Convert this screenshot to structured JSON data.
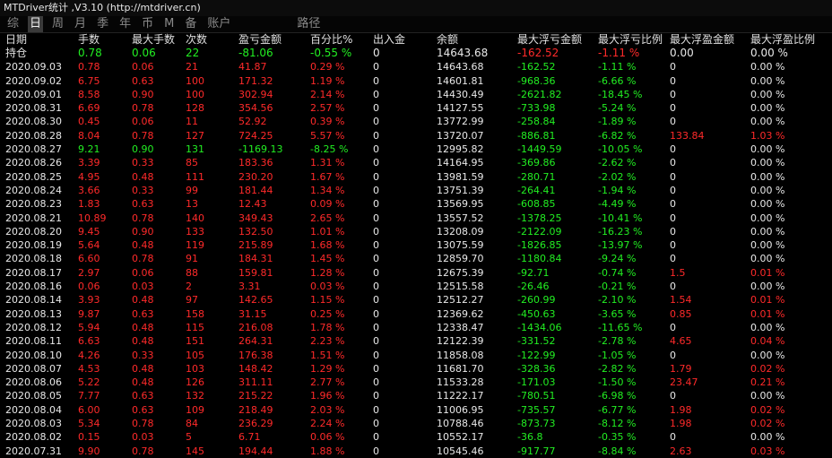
{
  "window_title": "MTDriver统计 ,V3.10 (http://mtdriver.cn)",
  "toolbar": {
    "buttons": [
      "综",
      "日",
      "周",
      "月",
      "季",
      "年",
      "币",
      "M",
      "备",
      "账户"
    ],
    "active_index": 1,
    "path_label": "路径"
  },
  "columns": [
    "日期",
    "手数",
    "最大手数",
    "次数",
    "盈亏金额",
    "百分比%",
    "出入金",
    "余额",
    "最大浮亏金额",
    "最大浮亏比例",
    "最大浮盈金额",
    "最大浮盈比例"
  ],
  "holding": {
    "label": "持仓",
    "values": [
      "0.78",
      "0.06",
      "22",
      "-81.06",
      "-0.55 %",
      "0",
      "14643.68",
      "-162.52",
      "-1.11 %",
      "0.00",
      "0.00 %"
    ]
  },
  "colors": {
    "loss": "#ff2a2a",
    "gain": "#22ee22",
    "text": "#e8e8e8",
    "background": "#000000"
  },
  "rows": [
    [
      "2020.09.03",
      "0.78",
      "0.06",
      "21",
      "41.87",
      "0.29 %",
      "0",
      "14643.68",
      "-162.52",
      "-1.11 %",
      "0",
      "0.00 %"
    ],
    [
      "2020.09.02",
      "6.75",
      "0.63",
      "100",
      "171.32",
      "1.19 %",
      "0",
      "14601.81",
      "-968.36",
      "-6.66 %",
      "0",
      "0.00 %"
    ],
    [
      "2020.09.01",
      "8.58",
      "0.90",
      "100",
      "302.94",
      "2.14 %",
      "0",
      "14430.49",
      "-2621.82",
      "-18.45 %",
      "0",
      "0.00 %"
    ],
    [
      "2020.08.31",
      "6.69",
      "0.78",
      "128",
      "354.56",
      "2.57 %",
      "0",
      "14127.55",
      "-733.98",
      "-5.24 %",
      "0",
      "0.00 %"
    ],
    [
      "2020.08.30",
      "0.45",
      "0.06",
      "11",
      "52.92",
      "0.39 %",
      "0",
      "13772.99",
      "-258.84",
      "-1.89 %",
      "0",
      "0.00 %"
    ],
    [
      "2020.08.28",
      "8.04",
      "0.78",
      "127",
      "724.25",
      "5.57 %",
      "0",
      "13720.07",
      "-886.81",
      "-6.82 %",
      "133.84",
      "1.03 %"
    ],
    [
      "2020.08.27",
      "9.21",
      "0.90",
      "131",
      "-1169.13",
      "-8.25 %",
      "0",
      "12995.82",
      "-1449.59",
      "-10.05 %",
      "0",
      "0.00 %"
    ],
    [
      "2020.08.26",
      "3.39",
      "0.33",
      "85",
      "183.36",
      "1.31 %",
      "0",
      "14164.95",
      "-369.86",
      "-2.62 %",
      "0",
      "0.00 %"
    ],
    [
      "2020.08.25",
      "4.95",
      "0.48",
      "111",
      "230.20",
      "1.67 %",
      "0",
      "13981.59",
      "-280.71",
      "-2.02 %",
      "0",
      "0.00 %"
    ],
    [
      "2020.08.24",
      "3.66",
      "0.33",
      "99",
      "181.44",
      "1.34 %",
      "0",
      "13751.39",
      "-264.41",
      "-1.94 %",
      "0",
      "0.00 %"
    ],
    [
      "2020.08.23",
      "1.83",
      "0.63",
      "13",
      "12.43",
      "0.09 %",
      "0",
      "13569.95",
      "-608.85",
      "-4.49 %",
      "0",
      "0.00 %"
    ],
    [
      "2020.08.21",
      "10.89",
      "0.78",
      "140",
      "349.43",
      "2.65 %",
      "0",
      "13557.52",
      "-1378.25",
      "-10.41 %",
      "0",
      "0.00 %"
    ],
    [
      "2020.08.20",
      "9.45",
      "0.90",
      "133",
      "132.50",
      "1.01 %",
      "0",
      "13208.09",
      "-2122.09",
      "-16.23 %",
      "0",
      "0.00 %"
    ],
    [
      "2020.08.19",
      "5.64",
      "0.48",
      "119",
      "215.89",
      "1.68 %",
      "0",
      "13075.59",
      "-1826.85",
      "-13.97 %",
      "0",
      "0.00 %"
    ],
    [
      "2020.08.18",
      "6.60",
      "0.78",
      "91",
      "184.31",
      "1.45 %",
      "0",
      "12859.70",
      "-1180.84",
      "-9.24 %",
      "0",
      "0.00 %"
    ],
    [
      "2020.08.17",
      "2.97",
      "0.06",
      "88",
      "159.81",
      "1.28 %",
      "0",
      "12675.39",
      "-92.71",
      "-0.74 %",
      "1.5",
      "0.01 %"
    ],
    [
      "2020.08.16",
      "0.06",
      "0.03",
      "2",
      "3.31",
      "0.03 %",
      "0",
      "12515.58",
      "-26.46",
      "-0.21 %",
      "0",
      "0.00 %"
    ],
    [
      "2020.08.14",
      "3.93",
      "0.48",
      "97",
      "142.65",
      "1.15 %",
      "0",
      "12512.27",
      "-260.99",
      "-2.10 %",
      "1.54",
      "0.01 %"
    ],
    [
      "2020.08.13",
      "9.87",
      "0.63",
      "158",
      "31.15",
      "0.25 %",
      "0",
      "12369.62",
      "-450.63",
      "-3.65 %",
      "0.85",
      "0.01 %"
    ],
    [
      "2020.08.12",
      "5.94",
      "0.48",
      "115",
      "216.08",
      "1.78 %",
      "0",
      "12338.47",
      "-1434.06",
      "-11.65 %",
      "0",
      "0.00 %"
    ],
    [
      "2020.08.11",
      "6.63",
      "0.48",
      "151",
      "264.31",
      "2.23 %",
      "0",
      "12122.39",
      "-331.52",
      "-2.78 %",
      "4.65",
      "0.04 %"
    ],
    [
      "2020.08.10",
      "4.26",
      "0.33",
      "105",
      "176.38",
      "1.51 %",
      "0",
      "11858.08",
      "-122.99",
      "-1.05 %",
      "0",
      "0.00 %"
    ],
    [
      "2020.08.07",
      "4.53",
      "0.48",
      "103",
      "148.42",
      "1.29 %",
      "0",
      "11681.70",
      "-328.36",
      "-2.82 %",
      "1.79",
      "0.02 %"
    ],
    [
      "2020.08.06",
      "5.22",
      "0.48",
      "126",
      "311.11",
      "2.77 %",
      "0",
      "11533.28",
      "-171.03",
      "-1.50 %",
      "23.47",
      "0.21 %"
    ],
    [
      "2020.08.05",
      "7.77",
      "0.63",
      "132",
      "215.22",
      "1.96 %",
      "0",
      "11222.17",
      "-780.51",
      "-6.98 %",
      "0",
      "0.00 %"
    ],
    [
      "2020.08.04",
      "6.00",
      "0.63",
      "109",
      "218.49",
      "2.03 %",
      "0",
      "11006.95",
      "-735.57",
      "-6.77 %",
      "1.98",
      "0.02 %"
    ],
    [
      "2020.08.03",
      "5.34",
      "0.78",
      "84",
      "236.29",
      "2.24 %",
      "0",
      "10788.46",
      "-873.73",
      "-8.12 %",
      "1.98",
      "0.02 %"
    ],
    [
      "2020.08.02",
      "0.15",
      "0.03",
      "5",
      "6.71",
      "0.06 %",
      "0",
      "10552.17",
      "-36.8",
      "-0.35 %",
      "0",
      "0.00 %"
    ],
    [
      "2020.07.31",
      "9.90",
      "0.78",
      "145",
      "194.44",
      "1.88 %",
      "0",
      "10545.46",
      "-917.77",
      "-8.84 %",
      "2.63",
      "0.03 %"
    ]
  ]
}
